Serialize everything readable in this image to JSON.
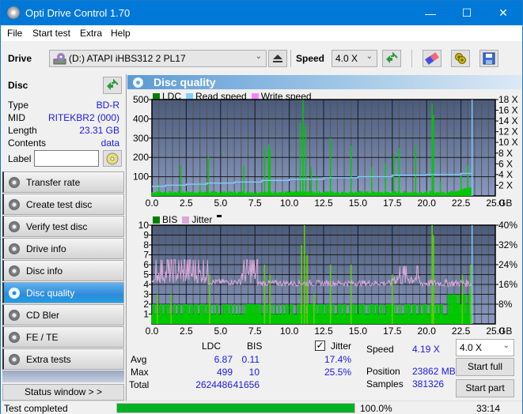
{
  "window": {
    "title": "Opti Drive Control 1.70",
    "controls": {
      "minimize": "—",
      "maximize": "☐",
      "close": "✕"
    }
  },
  "menu": [
    "File",
    "Start test",
    "Extra",
    "Help"
  ],
  "toolbar": {
    "drive_label": "Drive",
    "drive_value": "(D:)  ATAPI iHBS312  2 PL17",
    "speed_label": "Speed",
    "speed_value": "4.0 X",
    "icons": [
      "eject-icon",
      "refresh-icon",
      "erase-icon",
      "settings-icon",
      "save-icon"
    ]
  },
  "disc": {
    "header": "Disc",
    "rows": [
      {
        "key": "Type",
        "value": "BD-R"
      },
      {
        "key": "MID",
        "value": "RITEKBR2 (000)"
      },
      {
        "key": "Length",
        "value": "23.31 GB"
      },
      {
        "key": "Contents",
        "value": "data"
      }
    ],
    "label_key": "Label",
    "label_value": ""
  },
  "nav": [
    {
      "label": "Transfer rate",
      "active": false
    },
    {
      "label": "Create test disc",
      "active": false
    },
    {
      "label": "Verify test disc",
      "active": false
    },
    {
      "label": "Drive info",
      "active": false
    },
    {
      "label": "Disc info",
      "active": false
    },
    {
      "label": "Disc quality",
      "active": true
    },
    {
      "label": "CD Bler",
      "active": false
    },
    {
      "label": "FE / TE",
      "active": false
    },
    {
      "label": "Extra tests",
      "active": false
    }
  ],
  "status_window_button": "Status window > >",
  "panel_title": "Disc quality",
  "colors": {
    "ldc": "#00c800",
    "ldc_legend": "#008000",
    "read_speed": "#7fcfff",
    "write_speed": "#ff80ff",
    "bis": "#00c800",
    "bis_legend": "#008000",
    "jitter": "#d8a8d8",
    "plot_bg_top": "#4a5a7a",
    "plot_bg_bottom": "#8a9ac0",
    "accent": "#0078d7",
    "progress": "#06b025"
  },
  "chart_data": [
    {
      "type": "bar",
      "title": "LDC / Read speed",
      "legend": [
        "LDC",
        "Read speed",
        "Write speed"
      ],
      "xlabel": "GB",
      "x_ticks": [
        "0.0",
        "2.5",
        "5.0",
        "7.5",
        "10.0",
        "12.5",
        "15.0",
        "17.5",
        "20.0",
        "22.5",
        "25.0"
      ],
      "xlim": [
        0,
        25
      ],
      "ylim": [
        0,
        500
      ],
      "y_ticks": [
        "100",
        "200",
        "300",
        "400",
        "500"
      ],
      "y2lim": [
        0,
        18
      ],
      "y2_ticks": [
        "2 X",
        "4 X",
        "6 X",
        "8 X",
        "10 X",
        "12 X",
        "14 X",
        "16 X",
        "18 X"
      ],
      "grid": true,
      "legend_position": "top-left",
      "ldc_baseline": 12,
      "ldc_spikes": [
        {
          "x": 0.5,
          "y": 60
        },
        {
          "x": 2.1,
          "y": 155
        },
        {
          "x": 3.5,
          "y": 75
        },
        {
          "x": 4.1,
          "y": 205
        },
        {
          "x": 6.7,
          "y": 155
        },
        {
          "x": 8.2,
          "y": 250
        },
        {
          "x": 8.5,
          "y": 270
        },
        {
          "x": 8.6,
          "y": 235
        },
        {
          "x": 10.8,
          "y": 380
        },
        {
          "x": 11.0,
          "y": 499
        },
        {
          "x": 11.2,
          "y": 360
        },
        {
          "x": 11.6,
          "y": 150
        },
        {
          "x": 12.0,
          "y": 100
        },
        {
          "x": 13.0,
          "y": 300
        },
        {
          "x": 14.5,
          "y": 260
        },
        {
          "x": 16.0,
          "y": 150
        },
        {
          "x": 17.0,
          "y": 170
        },
        {
          "x": 17.6,
          "y": 220
        },
        {
          "x": 18.0,
          "y": 250
        },
        {
          "x": 19.2,
          "y": 255
        },
        {
          "x": 20.4,
          "y": 480
        },
        {
          "x": 20.5,
          "y": 420
        },
        {
          "x": 21.0,
          "y": 75
        },
        {
          "x": 22.5,
          "y": 120
        },
        {
          "x": 23.0,
          "y": 160
        }
      ],
      "read_speed": [
        {
          "x": 0.0,
          "y": 1.8
        },
        {
          "x": 1.0,
          "y": 2.0
        },
        {
          "x": 2.5,
          "y": 2.2
        },
        {
          "x": 4.0,
          "y": 2.4
        },
        {
          "x": 6.0,
          "y": 2.6
        },
        {
          "x": 8.0,
          "y": 2.9
        },
        {
          "x": 10.0,
          "y": 3.1
        },
        {
          "x": 12.5,
          "y": 3.4
        },
        {
          "x": 15.0,
          "y": 3.6
        },
        {
          "x": 17.5,
          "y": 3.9
        },
        {
          "x": 20.0,
          "y": 4.0
        },
        {
          "x": 22.5,
          "y": 4.2
        },
        {
          "x": 23.3,
          "y": 4.2
        }
      ],
      "end_marker_x": 23.31
    },
    {
      "type": "bar",
      "title": "BIS / Jitter",
      "legend": [
        "BIS",
        "Jitter"
      ],
      "xlabel": "GB",
      "x_ticks": [
        "0.0",
        "2.5",
        "5.0",
        "7.5",
        "10.0",
        "12.5",
        "15.0",
        "17.5",
        "20.0",
        "22.5",
        "25.0"
      ],
      "xlim": [
        0,
        25
      ],
      "ylim": [
        0,
        10
      ],
      "y_ticks": [
        "1",
        "2",
        "3",
        "4",
        "5",
        "6",
        "7",
        "8",
        "9",
        "10"
      ],
      "y2lim": [
        0,
        40
      ],
      "y2_ticks": [
        "8%",
        "16%",
        "24%",
        "32%",
        "40%"
      ],
      "grid": true,
      "legend_position": "top-left",
      "bis_spikes": [
        {
          "x": 0.4,
          "y": 3
        },
        {
          "x": 1.4,
          "y": 3
        },
        {
          "x": 4.2,
          "y": 5
        },
        {
          "x": 8.2,
          "y": 6
        },
        {
          "x": 8.6,
          "y": 5
        },
        {
          "x": 10.9,
          "y": 8
        },
        {
          "x": 11.1,
          "y": 10
        },
        {
          "x": 11.3,
          "y": 7
        },
        {
          "x": 11.8,
          "y": 3
        },
        {
          "x": 13.0,
          "y": 6
        },
        {
          "x": 14.5,
          "y": 6
        },
        {
          "x": 17.5,
          "y": 5
        },
        {
          "x": 20.4,
          "y": 10
        },
        {
          "x": 20.5,
          "y": 9
        },
        {
          "x": 22.6,
          "y": 5
        },
        {
          "x": 23.2,
          "y": 6
        }
      ],
      "jitter_segments": [
        {
          "from": 0.0,
          "to": 0.3,
          "base": 17.5,
          "amp": 1
        },
        {
          "from": 0.3,
          "to": 4.1,
          "base": 20,
          "amp": 6
        },
        {
          "from": 4.1,
          "to": 6.5,
          "base": 17,
          "amp": 2
        },
        {
          "from": 6.5,
          "to": 7.7,
          "base": 20,
          "amp": 6
        },
        {
          "from": 7.7,
          "to": 17.5,
          "base": 16.5,
          "amp": 2
        },
        {
          "from": 17.5,
          "to": 19.5,
          "base": 18.5,
          "amp": 5
        },
        {
          "from": 19.5,
          "to": 23.3,
          "base": 16.5,
          "amp": 2.5
        }
      ],
      "end_marker_x": 23.31
    }
  ],
  "stats": {
    "headers": [
      "LDC",
      "BIS"
    ],
    "jitter_label": "Jitter",
    "jitter_checked": true,
    "rows": [
      {
        "label": "Avg",
        "ldc": "6.87",
        "bis": "0.11",
        "jitter": "17.4%"
      },
      {
        "label": "Max",
        "ldc": "499",
        "bis": "10",
        "jitter": "25.5%"
      },
      {
        "label": "Total",
        "ldc": "2624486",
        "bis": "41656",
        "jitter": ""
      }
    ],
    "speed_label": "Speed",
    "speed_value": "4.19 X",
    "position_label": "Position",
    "position_value": "23862 MB",
    "samples_label": "Samples",
    "samples_value": "381326",
    "speed_select": "4.0 X",
    "start_full": "Start full",
    "start_part": "Start part"
  },
  "statusbar": {
    "text": "Test completed",
    "progress_percent": 100.0,
    "progress_text": "100.0%",
    "elapsed": "33:14"
  }
}
